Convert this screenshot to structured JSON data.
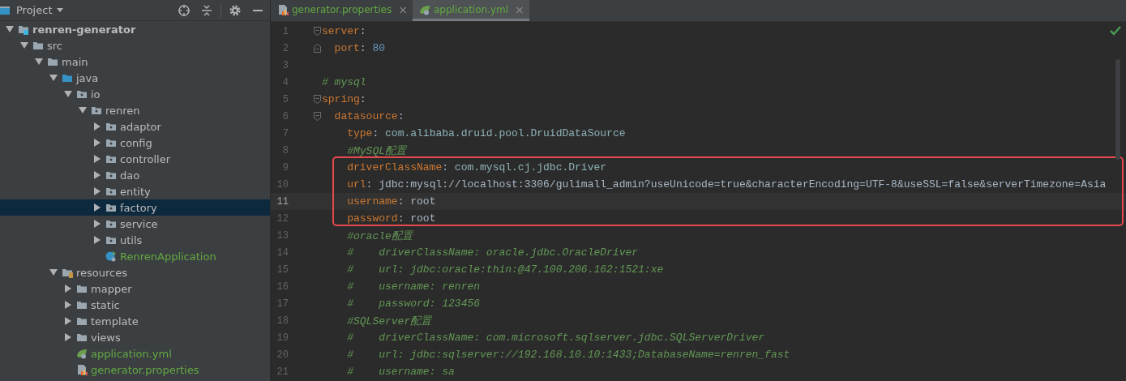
{
  "sidebar": {
    "title": "Project",
    "tree": [
      {
        "label": "renren-generator",
        "kind": "module",
        "expanded": true,
        "selected": false,
        "children": [
          {
            "label": "src",
            "kind": "folder",
            "expanded": true,
            "selected": false,
            "children": [
              {
                "label": "main",
                "kind": "folder",
                "expanded": true,
                "selected": false,
                "children": [
                  {
                    "label": "java",
                    "kind": "source-folder",
                    "expanded": true,
                    "selected": false,
                    "children": [
                      {
                        "label": "io",
                        "kind": "package",
                        "expanded": true,
                        "selected": false,
                        "children": [
                          {
                            "label": "renren",
                            "kind": "package",
                            "expanded": true,
                            "selected": false,
                            "children": [
                              {
                                "label": "adaptor",
                                "kind": "package",
                                "expanded": false,
                                "selected": false
                              },
                              {
                                "label": "config",
                                "kind": "package",
                                "expanded": false,
                                "selected": false
                              },
                              {
                                "label": "controller",
                                "kind": "package",
                                "expanded": false,
                                "selected": false
                              },
                              {
                                "label": "dao",
                                "kind": "package",
                                "expanded": false,
                                "selected": false
                              },
                              {
                                "label": "entity",
                                "kind": "package",
                                "expanded": false,
                                "selected": false
                              },
                              {
                                "label": "factory",
                                "kind": "package",
                                "expanded": false,
                                "selected": true
                              },
                              {
                                "label": "service",
                                "kind": "package",
                                "expanded": false,
                                "selected": false
                              },
                              {
                                "label": "utils",
                                "kind": "package",
                                "expanded": false,
                                "selected": false
                              },
                              {
                                "label": "RenrenApplication",
                                "kind": "spring-class",
                                "selected": false
                              }
                            ]
                          }
                        ]
                      }
                    ]
                  },
                  {
                    "label": "resources",
                    "kind": "resources",
                    "expanded": true,
                    "selected": false,
                    "children": [
                      {
                        "label": "mapper",
                        "kind": "folder",
                        "expanded": false,
                        "selected": false
                      },
                      {
                        "label": "static",
                        "kind": "folder",
                        "expanded": false,
                        "selected": false
                      },
                      {
                        "label": "template",
                        "kind": "folder",
                        "expanded": false,
                        "selected": false
                      },
                      {
                        "label": "views",
                        "kind": "folder",
                        "expanded": false,
                        "selected": false
                      },
                      {
                        "label": "application.yml",
                        "kind": "spring-config",
                        "selected": false
                      },
                      {
                        "label": "generator.properties",
                        "kind": "properties",
                        "selected": false
                      }
                    ]
                  }
                ]
              }
            ]
          }
        ]
      }
    ]
  },
  "tabs": [
    {
      "label": "generator.properties",
      "kind": "properties",
      "close": "×",
      "selected": false
    },
    {
      "label": "application.yml",
      "kind": "spring-config",
      "close": "×",
      "selected": true
    }
  ],
  "editor": {
    "lines": [
      {
        "number": "1",
        "kind": "fold-start",
        "tokens": [
          {
            "kind": "key",
            "text": "server"
          },
          {
            "kind": "punct",
            "text": ":"
          }
        ]
      },
      {
        "number": "2",
        "kind": "fold-end",
        "tokens": [
          {
            "kind": "key",
            "text": "  port"
          },
          {
            "kind": "punct",
            "text": ": "
          },
          {
            "kind": "number",
            "text": "80"
          }
        ]
      },
      {
        "number": "3"
      },
      {
        "number": "4",
        "tokens": [
          {
            "kind": "comment",
            "text": "# mysql"
          }
        ]
      },
      {
        "number": "5",
        "kind": "fold-start",
        "tokens": [
          {
            "kind": "key",
            "text": "spring"
          },
          {
            "kind": "punct",
            "text": ":"
          }
        ]
      },
      {
        "number": "6",
        "kind": "fold-start",
        "tokens": [
          {
            "kind": "key",
            "text": "  datasource"
          },
          {
            "kind": "punct",
            "text": ":"
          }
        ]
      },
      {
        "number": "7",
        "tokens": [
          {
            "kind": "key",
            "text": "    type"
          },
          {
            "kind": "punct",
            "text": ": "
          },
          {
            "kind": "value",
            "text": "com.alibaba.druid.pool.DruidDataSource"
          }
        ]
      },
      {
        "number": "8",
        "tokens": [
          {
            "kind": "comment",
            "text": "    #MySQL配置"
          }
        ]
      },
      {
        "number": "9",
        "boxed": true,
        "tokens": [
          {
            "kind": "key",
            "text": "    driverClassName"
          },
          {
            "kind": "punct",
            "text": ": "
          },
          {
            "kind": "value",
            "text": "com.mysql.cj.jdbc.Driver"
          }
        ]
      },
      {
        "number": "10",
        "boxed": true,
        "tokens": [
          {
            "kind": "key",
            "text": "    url"
          },
          {
            "kind": "punct",
            "text": ": "
          },
          {
            "kind": "plain",
            "text": "jdbc:mysql://localhost:3306/gulimall_admin?useUnicode=true&characterEncoding=UTF-8&useSSL=false&serverTimezone=Asia"
          }
        ]
      },
      {
        "number": "11",
        "boxed": true,
        "current": true,
        "tokens": [
          {
            "kind": "key",
            "text": "    username"
          },
          {
            "kind": "punct",
            "text": ": "
          },
          {
            "kind": "plain",
            "text": "root"
          }
        ]
      },
      {
        "number": "12",
        "boxed": true,
        "tokens": [
          {
            "kind": "key",
            "text": "    password"
          },
          {
            "kind": "punct",
            "text": ": "
          },
          {
            "kind": "plain",
            "text": "root"
          }
        ]
      },
      {
        "number": "13",
        "tokens": [
          {
            "kind": "comment",
            "text": "    #oracle配置"
          }
        ]
      },
      {
        "number": "14",
        "tokens": [
          {
            "kind": "comment",
            "text": "    #    driverClassName: oracle.jdbc.OracleDriver"
          }
        ]
      },
      {
        "number": "15",
        "tokens": [
          {
            "kind": "comment",
            "text": "    #    url: jdbc:oracle:thin:@47.100.206.162:1521:xe"
          }
        ]
      },
      {
        "number": "16",
        "tokens": [
          {
            "kind": "comment",
            "text": "    #    username: renren"
          }
        ]
      },
      {
        "number": "17",
        "tokens": [
          {
            "kind": "comment",
            "text": "    #    password: 123456"
          }
        ]
      },
      {
        "number": "18",
        "tokens": [
          {
            "kind": "comment",
            "text": "    #SQLServer配置"
          }
        ]
      },
      {
        "number": "19",
        "tokens": [
          {
            "kind": "comment",
            "text": "    #    driverClassName: com.microsoft.sqlserver.jdbc.SQLServerDriver"
          }
        ]
      },
      {
        "number": "20",
        "tokens": [
          {
            "kind": "comment",
            "text": "    #    url: jdbc:sqlserver://192.168.10.10:1433;DatabaseName=renren_fast"
          }
        ]
      },
      {
        "number": "21",
        "tokens": [
          {
            "kind": "comment",
            "text": "    #    username: sa"
          }
        ]
      }
    ]
  }
}
